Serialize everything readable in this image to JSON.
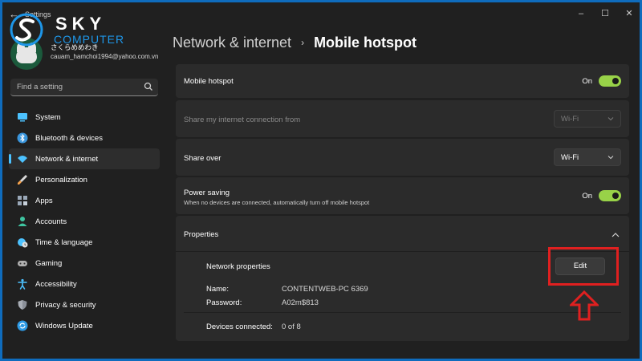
{
  "window": {
    "title": "Settings",
    "back_icon": "back-arrow-icon",
    "controls": {
      "minimize": "–",
      "maximize": "☐",
      "close": "✕"
    }
  },
  "watermark": {
    "brand": "SKY",
    "tagline": "COMPUTER"
  },
  "profile": {
    "name": "さくらめめわき",
    "email": "cauam_hamchoi1994@yahoo.com.vn"
  },
  "search": {
    "placeholder": "Find a setting",
    "icon": "search-icon"
  },
  "sidebar": {
    "items": [
      {
        "label": "System",
        "icon": "system-icon",
        "color": "#4cc2ff",
        "active": false
      },
      {
        "label": "Bluetooth & devices",
        "icon": "bluetooth-icon",
        "color": "#3a96dd",
        "active": false
      },
      {
        "label": "Network & internet",
        "icon": "wifi-icon",
        "color": "#4cc2ff",
        "active": true
      },
      {
        "label": "Personalization",
        "icon": "brush-icon",
        "color": "#f7a24b",
        "active": false
      },
      {
        "label": "Apps",
        "icon": "apps-icon",
        "color": "#9aa8b8",
        "active": false
      },
      {
        "label": "Accounts",
        "icon": "person-icon",
        "color": "#3fc4a0",
        "active": false
      },
      {
        "label": "Time & language",
        "icon": "globe-clock-icon",
        "color": "#4cc2ff",
        "active": false
      },
      {
        "label": "Gaming",
        "icon": "gamepad-icon",
        "color": "#b0b0b0",
        "active": false
      },
      {
        "label": "Accessibility",
        "icon": "accessibility-icon",
        "color": "#4cc2ff",
        "active": false
      },
      {
        "label": "Privacy & security",
        "icon": "shield-icon",
        "color": "#8a8f98",
        "active": false
      },
      {
        "label": "Windows Update",
        "icon": "update-icon",
        "color": "#2e9be6",
        "active": false
      }
    ]
  },
  "breadcrumb": {
    "parent": "Network & internet",
    "separator": "›",
    "current": "Mobile hotspot"
  },
  "settings": {
    "mobile_hotspot": {
      "label": "Mobile hotspot",
      "state": "On",
      "enabled": true
    },
    "share_from": {
      "label": "Share my internet connection from",
      "value": "Wi-Fi",
      "disabled": true
    },
    "share_over": {
      "label": "Share over",
      "value": "Wi-Fi"
    },
    "power_saving": {
      "label": "Power saving",
      "description": "When no devices are connected, automatically turn off mobile hotspot",
      "state": "On",
      "enabled": true
    },
    "properties": {
      "label": "Properties",
      "expanded": true,
      "network_properties_label": "Network properties",
      "edit_label": "Edit",
      "name_label": "Name:",
      "name_value": "CONTENTWEB-PC 6369",
      "password_label": "Password:",
      "password_value": "A02m$813",
      "devices_label": "Devices connected:",
      "devices_value": "0 of 8"
    }
  },
  "annotation": {
    "color": "#e02020",
    "icon": "up-arrow-icon"
  }
}
